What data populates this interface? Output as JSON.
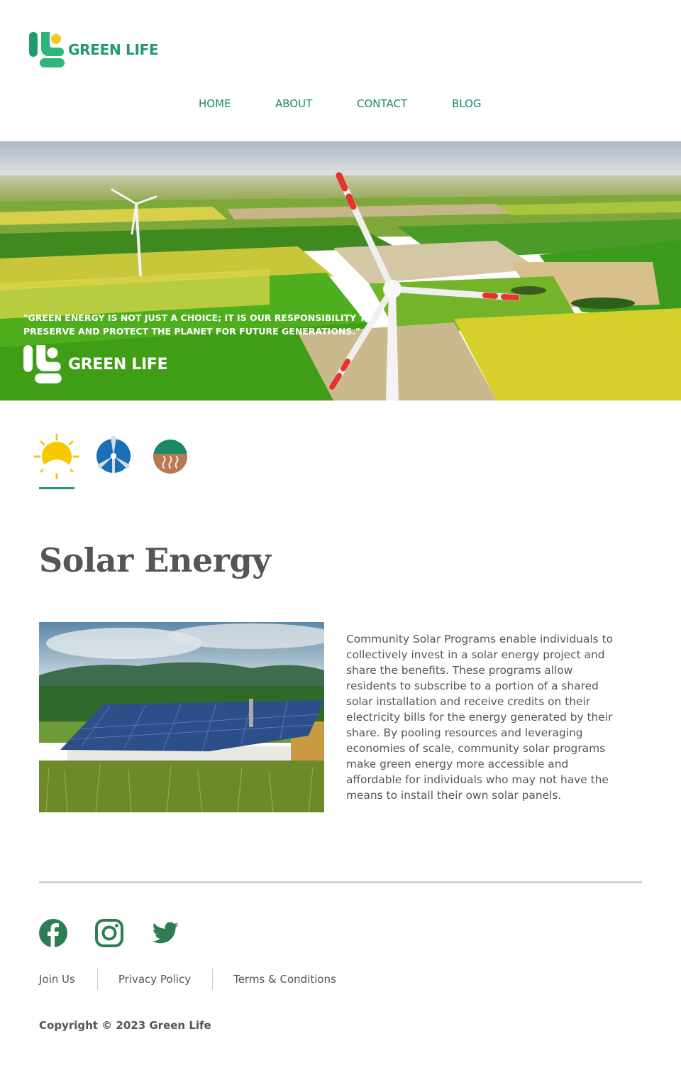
{
  "brand": {
    "name": "GREEN LIFE",
    "primary_color": "#1f9a6b",
    "secondary_color": "#f2c81a"
  },
  "nav": {
    "items": [
      {
        "label": "HOME"
      },
      {
        "label": "ABOUT"
      },
      {
        "label": "CONTACT"
      },
      {
        "label": "BLOG"
      }
    ]
  },
  "hero": {
    "quote_line1": "\"GREEN ENERGY IS NOT JUST A CHOICE; IT IS OUR RESPONSIBILITY TO",
    "quote_line2": "PRESERVE AND PROTECT THE PLANET FOR FUTURE GENERATIONS.\"",
    "logo_text": "GREEN LIFE",
    "image": "wind-turbines-over-farmland"
  },
  "energy_tabs": [
    {
      "name": "solar",
      "icon": "sun-icon",
      "active": true
    },
    {
      "name": "wind",
      "icon": "wind-turbine-icon",
      "active": false
    },
    {
      "name": "geothermal",
      "icon": "geothermal-icon",
      "active": false
    }
  ],
  "section": {
    "title": "Solar Energy",
    "image": "solar-panels-on-house-roof",
    "body": "Community Solar Programs enable individuals to collectively invest in a solar energy project and share the benefits. These programs allow residents to subscribe to a portion of a shared solar installation and receive credits on their electricity bills for the energy generated by their share. By pooling resources and leveraging economies of scale, community solar programs make green energy more accessible and affordable for individuals who may not have the means to install their own solar panels."
  },
  "footer": {
    "social": [
      {
        "name": "facebook",
        "icon": "facebook-icon"
      },
      {
        "name": "instagram",
        "icon": "instagram-icon"
      },
      {
        "name": "twitter",
        "icon": "twitter-icon"
      }
    ],
    "links": [
      {
        "label": "Join Us"
      },
      {
        "label": "Privacy Policy"
      },
      {
        "label": "Terms & Conditions"
      }
    ],
    "copyright": "Copyright © 2023 Green Life"
  }
}
